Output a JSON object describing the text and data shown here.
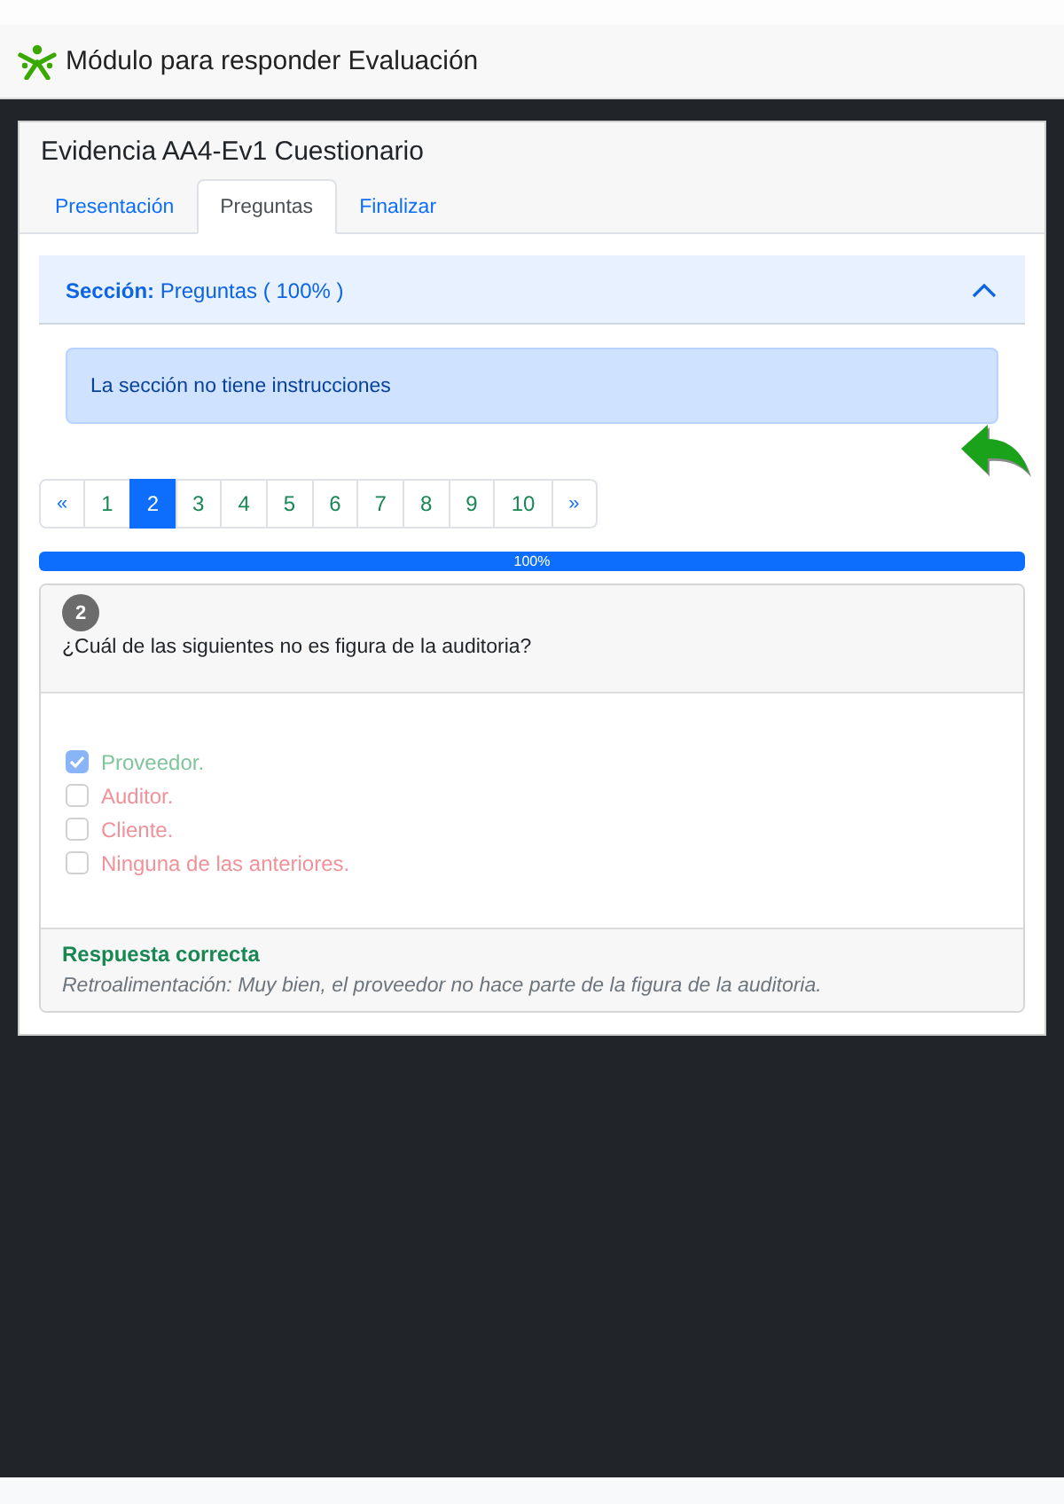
{
  "app_header": {
    "title": "Módulo para responder Evaluación"
  },
  "card": {
    "title": "Evidencia AA4-Ev1 Cuestionario",
    "tabs": [
      {
        "label": "Presentación",
        "selected": false
      },
      {
        "label": "Preguntas",
        "selected": true
      },
      {
        "label": "Finalizar",
        "selected": false
      }
    ]
  },
  "section": {
    "title": "**Sección:** Preguntas ( 100% )",
    "expanded": true,
    "instructions": "La sección no tiene instrucciones"
  },
  "pagination": [
    {
      "label": "«",
      "kind": "prev",
      "selected": false
    },
    {
      "label": "1",
      "kind": "page",
      "selected": false
    },
    {
      "label": "2",
      "kind": "page",
      "selected": true
    },
    {
      "label": "3",
      "kind": "page",
      "selected": false
    },
    {
      "label": "4",
      "kind": "page",
      "selected": false
    },
    {
      "label": "5",
      "kind": "page",
      "selected": false
    },
    {
      "label": "6",
      "kind": "page",
      "selected": false
    },
    {
      "label": "7",
      "kind": "page",
      "selected": false
    },
    {
      "label": "8",
      "kind": "page",
      "selected": false
    },
    {
      "label": "9",
      "kind": "page",
      "selected": false
    },
    {
      "label": "10",
      "kind": "page",
      "selected": false
    },
    {
      "label": "»",
      "kind": "next",
      "selected": false
    }
  ],
  "progress": {
    "level": 1,
    "label": "100%"
  },
  "question": {
    "number": "2",
    "text": "¿Cuál de las siguientes no es figura de la auditoria?",
    "options": [
      {
        "label": "Proveedor.",
        "checked": true,
        "correct": true
      },
      {
        "label": "Auditor.",
        "checked": false,
        "correct": false
      },
      {
        "label": "Cliente.",
        "checked": false,
        "correct": false
      },
      {
        "label": "Ninguna de las anteriores.",
        "checked": false,
        "correct": false
      }
    ],
    "result": "Respuesta correcta",
    "feedback": "Retroalimentación: Muy bien, el proveedor no hace parte de la figura de la auditoria."
  }
}
